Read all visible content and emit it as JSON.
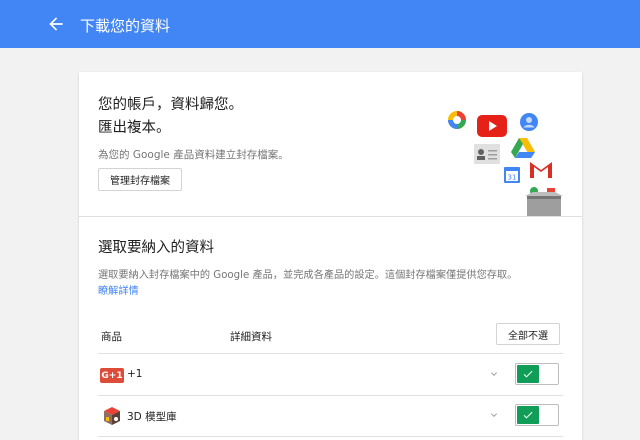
{
  "appbar": {
    "title": "下載您的資料",
    "back_icon": "arrow-back-icon",
    "color": "#4285f4"
  },
  "hero": {
    "headline_line1": "您的帳戶，資料歸您。",
    "headline_line2": "匯出複本。",
    "subtext": "為您的 Google 產品資料建立封存檔案。",
    "manage_button": "管理封存檔案",
    "icons": [
      "picasa-icon",
      "youtube-icon",
      "profile-icon",
      "contacts-icon",
      "drive-icon",
      "calendar-icon",
      "gmail-icon",
      "archive-box-icon"
    ]
  },
  "section": {
    "title": "選取要納入的資料",
    "description": "選取要納入封存檔案中的 Google 產品，並完成各產品的設定。這個封存檔案僅提供您存取。",
    "learn_more": "瞭解詳情"
  },
  "table": {
    "col_product": "商品",
    "col_details": "詳細資料",
    "deselect_all": "全部不選",
    "rows": [
      {
        "name": "+1",
        "icon": "google-plus-one-icon",
        "badge": "G+1",
        "selected": true
      },
      {
        "name": "3D 模型庫",
        "icon": "3d-warehouse-icon",
        "selected": true
      }
    ]
  },
  "colors": {
    "toggle_on": "#0f9d58",
    "link": "#4285f4"
  }
}
